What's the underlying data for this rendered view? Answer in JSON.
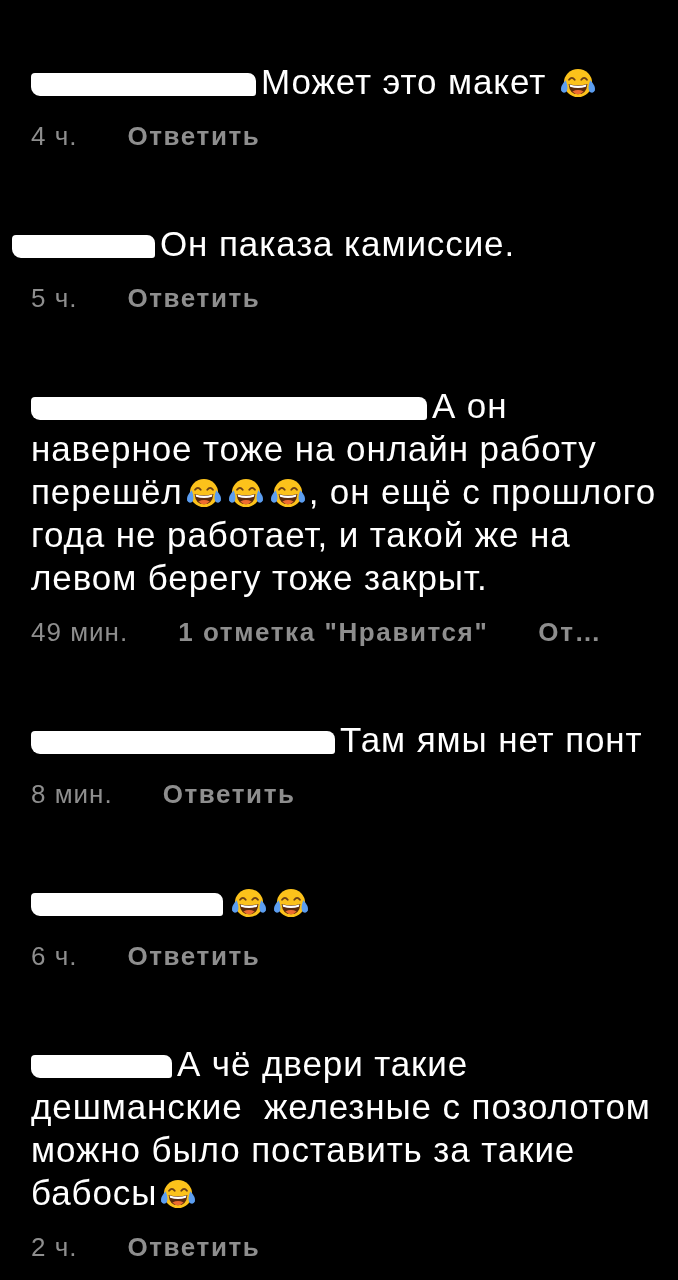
{
  "comments": [
    {
      "username_redacted": true,
      "body": [
        {
          "kind": "text",
          "text": "Может это макет "
        },
        {
          "kind": "emoji"
        }
      ],
      "meta": [
        {
          "kind": "time",
          "text": "4 ч."
        },
        {
          "kind": "reply",
          "text": "Ответить"
        }
      ]
    },
    {
      "username_redacted": true,
      "body": [
        {
          "kind": "text",
          "text": "Он паказа камиссие."
        }
      ],
      "meta": [
        {
          "kind": "time",
          "text": "5 ч."
        },
        {
          "kind": "reply",
          "text": "Ответить"
        }
      ]
    },
    {
      "username_redacted": true,
      "body": [
        {
          "kind": "text",
          "text": "А он наверное тоже на онлайн работу перешёл"
        },
        {
          "kind": "emoji"
        },
        {
          "kind": "emoji"
        },
        {
          "kind": "emoji"
        },
        {
          "kind": "text",
          "text": ", он ещё с прошлого года не работает, и такой же на левом берегу тоже закрыт."
        }
      ],
      "meta": [
        {
          "kind": "time",
          "text": "49 мин."
        },
        {
          "kind": "likes",
          "text": "1 отметка \"Нравится\""
        },
        {
          "kind": "reply",
          "text": "От…"
        }
      ]
    },
    {
      "username_redacted": true,
      "body": [
        {
          "kind": "text",
          "text": "Там ямы нет понт"
        }
      ],
      "meta": [
        {
          "kind": "time",
          "text": "8 мин."
        },
        {
          "kind": "reply",
          "text": "Ответить"
        }
      ]
    },
    {
      "username_redacted": true,
      "body": [
        {
          "kind": "emoji"
        },
        {
          "kind": "emoji"
        }
      ],
      "meta": [
        {
          "kind": "time",
          "text": "6 ч."
        },
        {
          "kind": "reply",
          "text": "Ответить"
        }
      ]
    },
    {
      "username_redacted": true,
      "body": [
        {
          "kind": "text",
          "text": "А чё двери такие дешманские  железные с позолотом можно было поставить за такие бабосы"
        },
        {
          "kind": "emoji"
        }
      ],
      "meta": [
        {
          "kind": "time",
          "text": "2 ч."
        },
        {
          "kind": "reply",
          "text": "Ответить"
        }
      ]
    }
  ]
}
